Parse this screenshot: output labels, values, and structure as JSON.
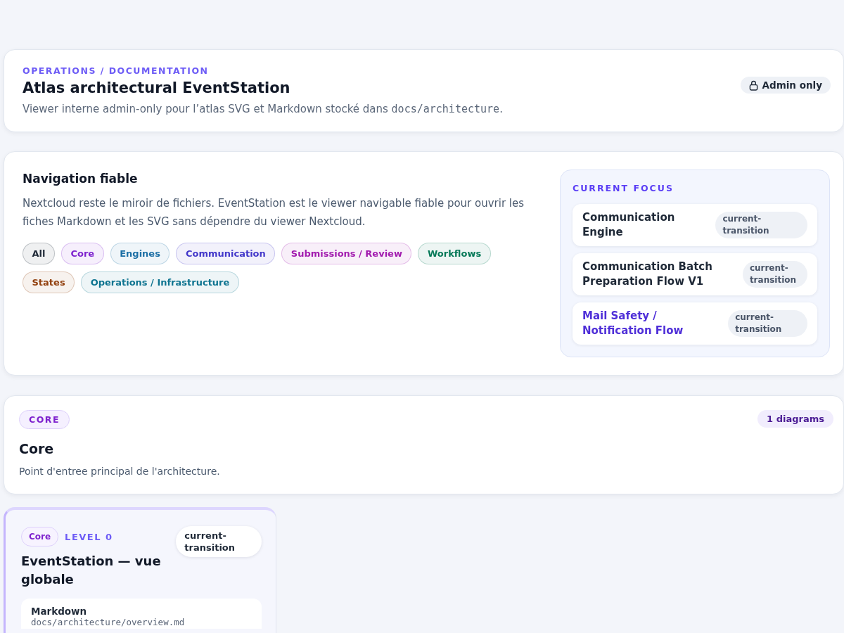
{
  "header": {
    "eyebrow": "OPERATIONS / DOCUMENTATION",
    "title": "Atlas architectural EventStation",
    "description": [
      {
        "kind": "text",
        "text": "Viewer interne admin-only pour l’atlas SVG et Markdown stocké dans "
      },
      {
        "kind": "code",
        "text": "docs/architecture"
      },
      {
        "kind": "text",
        "text": "."
      }
    ],
    "access_badge": "Admin only"
  },
  "navigation": {
    "title": "Navigation fiable",
    "text": "Nextcloud reste le miroir de fichiers. EventStation est le viewer navigable fiable pour ouvrir les fiches Markdown et les SVG sans dépendre du viewer Nextcloud.",
    "filters": [
      {
        "label": "All",
        "color": "#1f2937"
      },
      {
        "label": "Core",
        "color": "#7e22ce"
      },
      {
        "label": "Engines",
        "color": "#1d6fa5"
      },
      {
        "label": "Communication",
        "color": "#4338ca"
      },
      {
        "label": "Submissions / Review",
        "color": "#a21caf"
      },
      {
        "label": "Workflows",
        "color": "#047857"
      },
      {
        "label": "States",
        "color": "#92400e"
      },
      {
        "label": "Operations / Infrastructure",
        "color": "#0e7490"
      }
    ],
    "current_focus": {
      "title": "CURRENT FOCUS",
      "items": [
        {
          "title": "Communication Engine",
          "status": "current-transition",
          "selected": false
        },
        {
          "title": "Communication Batch Preparation Flow V1",
          "status": "current-transition",
          "selected": false
        },
        {
          "title": "Mail Safety / Notification Flow",
          "status": "current-transition",
          "selected": true
        }
      ]
    }
  },
  "sections": [
    {
      "tag": "CORE",
      "count": "1 diagrams",
      "title": "Core",
      "description": "Point d'entree principal de l'architecture.",
      "diagrams": [
        {
          "category": "Core",
          "level": "LEVEL 0",
          "status": "current-transition",
          "title": "EventStation — vue globale",
          "files": [
            {
              "label": "Markdown",
              "path": "docs/architecture/overview.md"
            }
          ]
        }
      ]
    }
  ]
}
